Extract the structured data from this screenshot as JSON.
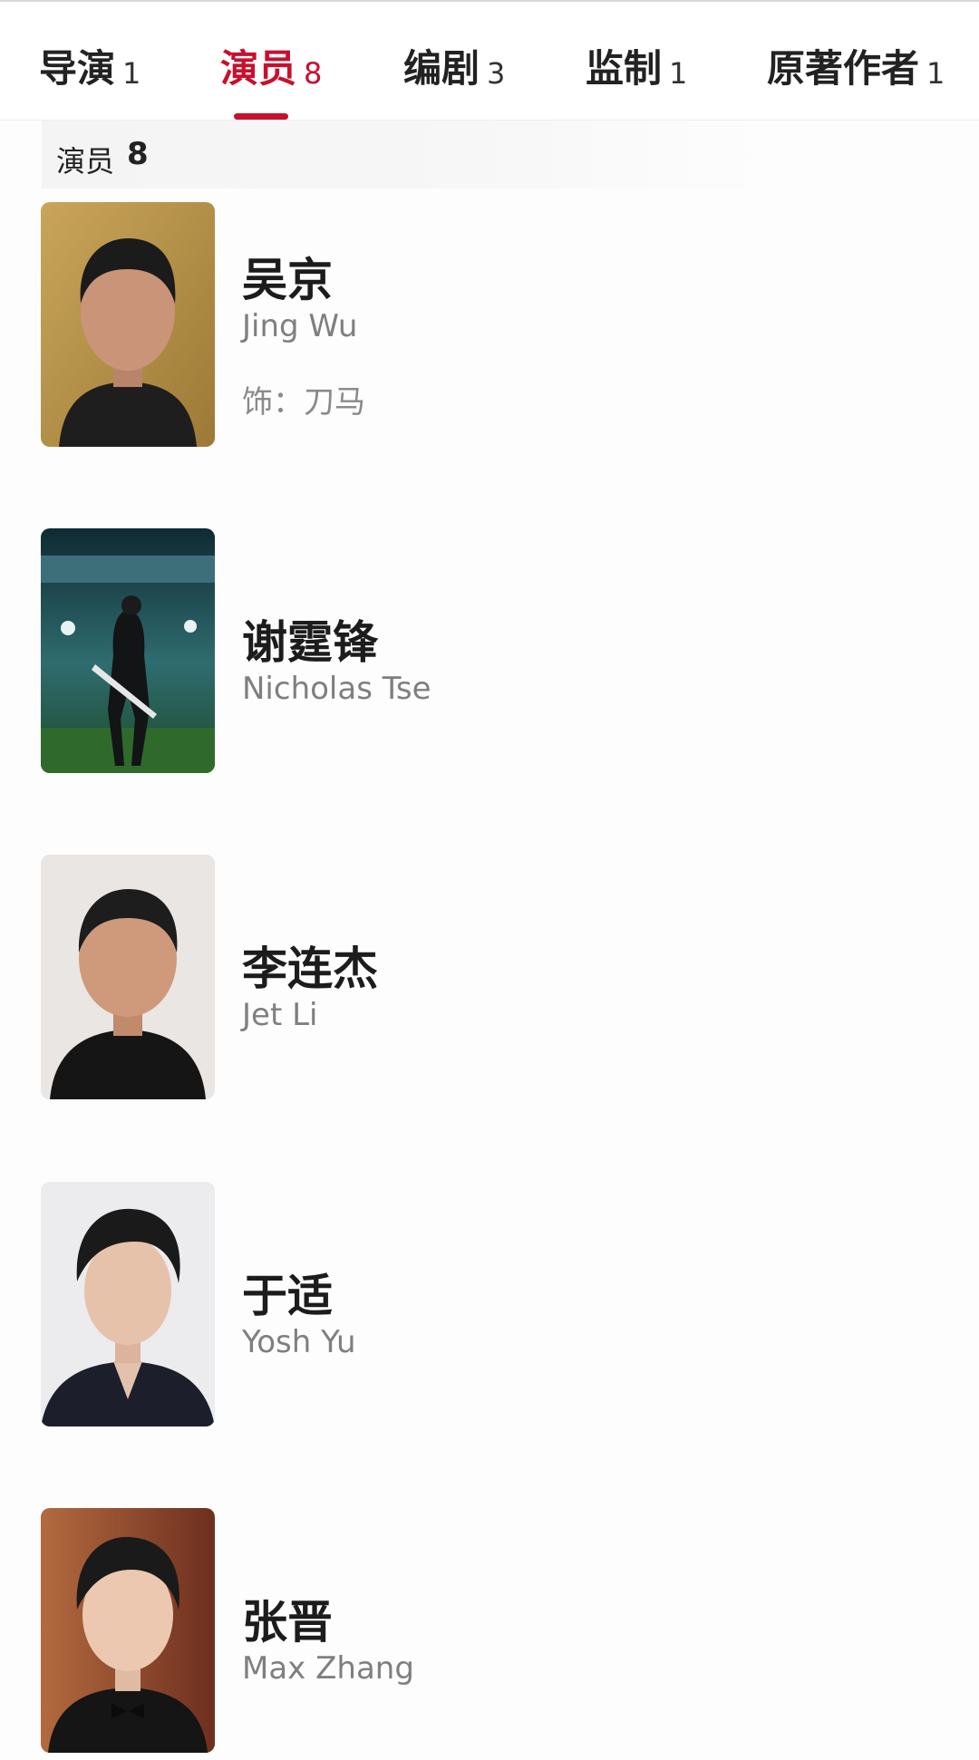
{
  "tabs": [
    {
      "label": "导演",
      "count": "1"
    },
    {
      "label": "演员",
      "count": "8",
      "active": true
    },
    {
      "label": "编剧",
      "count": "3"
    },
    {
      "label": "监制",
      "count": "1"
    },
    {
      "label": "原著作者",
      "count": "1"
    }
  ],
  "section": {
    "label": "演员",
    "count": "8"
  },
  "cast": [
    {
      "name": "吴京",
      "name_en": "Jing Wu",
      "role": "饰：刀马",
      "photo_icon": "actor-portrait-photo"
    },
    {
      "name": "谢霆锋",
      "name_en": "Nicholas Tse",
      "photo_icon": "actor-stadium-photo"
    },
    {
      "name": "李连杰",
      "name_en": "Jet Li",
      "photo_icon": "actor-portrait-photo"
    },
    {
      "name": "于适",
      "name_en": "Yosh Yu",
      "photo_icon": "actor-portrait-photo"
    },
    {
      "name": "张晋",
      "name_en": "Max Zhang",
      "photo_icon": "actor-portrait-photo"
    }
  ],
  "colors": {
    "accent": "#c8102e",
    "text": "#222222",
    "muted": "#7f7f7f"
  }
}
